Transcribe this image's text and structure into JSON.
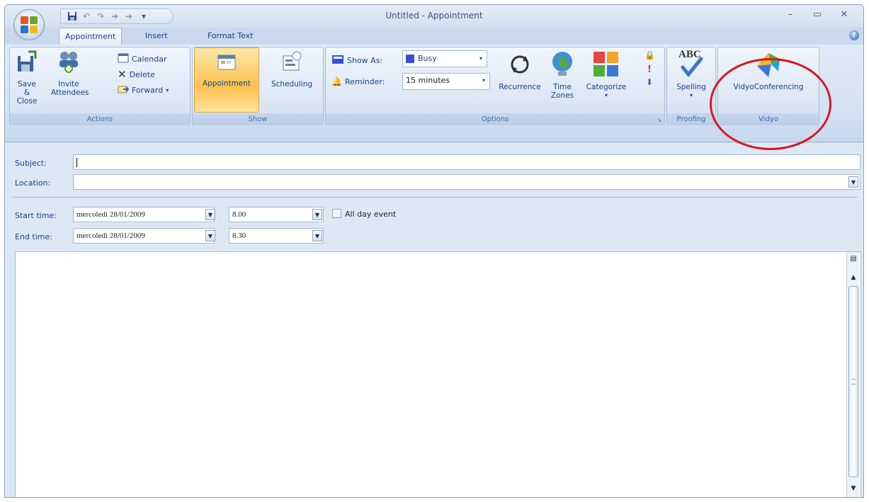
{
  "window": {
    "title": "Untitled - Appointment"
  },
  "quick_access": {
    "icons": [
      "save-icon",
      "undo-icon",
      "redo-icon",
      "previous-item-icon",
      "next-item-icon"
    ]
  },
  "tabs": [
    {
      "label": "Appointment",
      "active": true
    },
    {
      "label": "Insert",
      "active": false
    },
    {
      "label": "Format Text",
      "active": false
    }
  ],
  "ribbon": {
    "actions": {
      "label": "Actions",
      "save_close_line1": "Save &",
      "save_close_line2": "Close",
      "invite_line1": "Invite",
      "invite_line2": "Attendees",
      "calendar": "Calendar",
      "delete": "Delete",
      "forward": "Forward"
    },
    "show": {
      "label": "Show",
      "appointment": "Appointment",
      "scheduling": "Scheduling"
    },
    "options": {
      "label": "Options",
      "show_as_label": "Show As:",
      "show_as_value": "Busy",
      "reminder_label": "Reminder:",
      "reminder_value": "15 minutes",
      "recurrence": "Recurrence",
      "time_zones_line1": "Time",
      "time_zones_line2": "Zones",
      "categorize": "Categorize"
    },
    "proofing": {
      "label": "Proofing",
      "spelling": "Spelling",
      "abc": "ABC"
    },
    "vidyo": {
      "label": "Vidyo",
      "button": "VidyoConferencing"
    }
  },
  "form": {
    "subject_label": "Subject:",
    "subject_value": "",
    "location_label": "Location:",
    "location_value": "",
    "start_label": "Start time:",
    "start_date": "mercoledì 28/01/2009",
    "start_time": "8.00",
    "end_label": "End time:",
    "end_date": "mercoledì 28/01/2009",
    "end_time": "8.30",
    "all_day_label": "All day event"
  },
  "colors": {
    "accent": "#15428b",
    "highlight": "#e0141c",
    "busy": "#3a4fd8"
  }
}
